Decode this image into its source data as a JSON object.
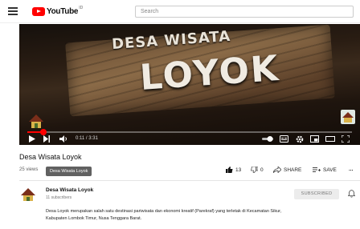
{
  "header": {
    "logo_text": "YouTube",
    "logo_sup": "ID",
    "search_placeholder": "Search"
  },
  "player": {
    "sign_top": "DESA WISATA",
    "sign_main": "LOYOK",
    "time": "0:11 / 3:31",
    "progress": 0.05
  },
  "video": {
    "title": "Desa Wisata Loyok",
    "views": "25 views",
    "tooltip": "Desa Wisata Loyok",
    "likes": "13",
    "dislikes": "0",
    "share_label": "SHARE",
    "save_label": "SAVE",
    "more_label": "..."
  },
  "channel": {
    "name": "Desa Wisata Loyok",
    "subscribers": "11 subscribers",
    "subscribe_label": "SUBSCRIBED",
    "description": "Desa Loyok merupakan salah satu destinasi pariwisata dan ekonomi kreatif (Parekraf) yang terletak di Kecamatan Sikur, Kabupaten Lombok Timur, Nusa Tenggara Barat."
  },
  "colors": {
    "brand": "#ff0000",
    "progress": "#ff0000"
  },
  "icons": [
    "menu-icon",
    "youtube-logo-icon",
    "play-icon",
    "next-icon",
    "volume-icon",
    "autoplay-icon",
    "subtitles-icon",
    "settings-icon",
    "miniplayer-icon",
    "theater-icon",
    "fullscreen-icon",
    "like-icon",
    "dislike-icon",
    "share-icon",
    "save-icon",
    "bell-icon"
  ]
}
